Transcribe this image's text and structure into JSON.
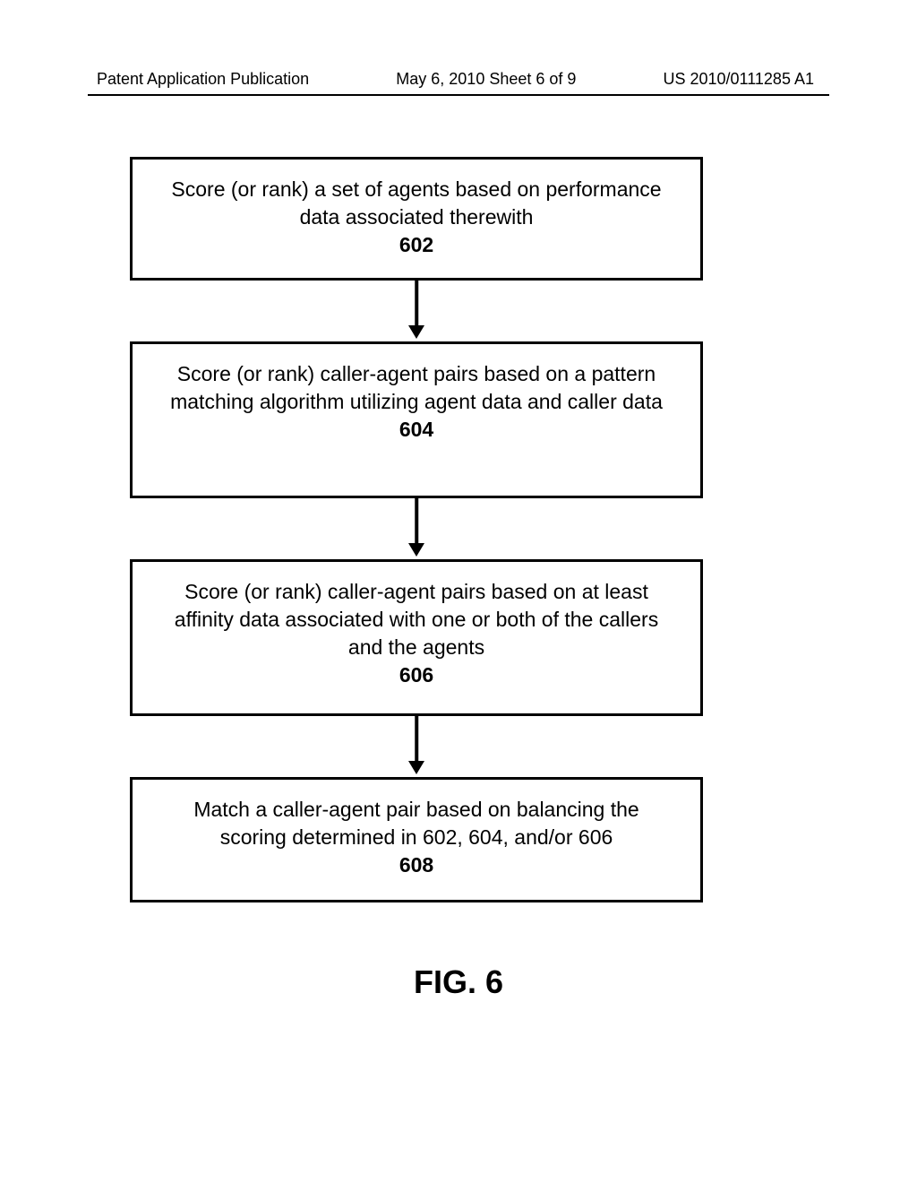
{
  "header": {
    "left": "Patent Application Publication",
    "center": "May 6, 2010  Sheet 6 of 9",
    "right": "US 2010/0111285 A1"
  },
  "diagram": {
    "boxes": [
      {
        "text": "Score (or rank) a set of agents based on performance data associated therewith",
        "number": "602"
      },
      {
        "text": "Score (or rank) caller-agent pairs based on a pattern matching algorithm utilizing agent data and caller data",
        "number": "604"
      },
      {
        "text": "Score (or rank) caller-agent pairs based on at least affinity data associated with one or both of the callers and the agents",
        "number": "606"
      },
      {
        "text": "Match a caller-agent pair based on balancing the scoring determined in 602, 604, and/or 606",
        "number": "608"
      }
    ],
    "figure_label": "FIG. 6"
  }
}
